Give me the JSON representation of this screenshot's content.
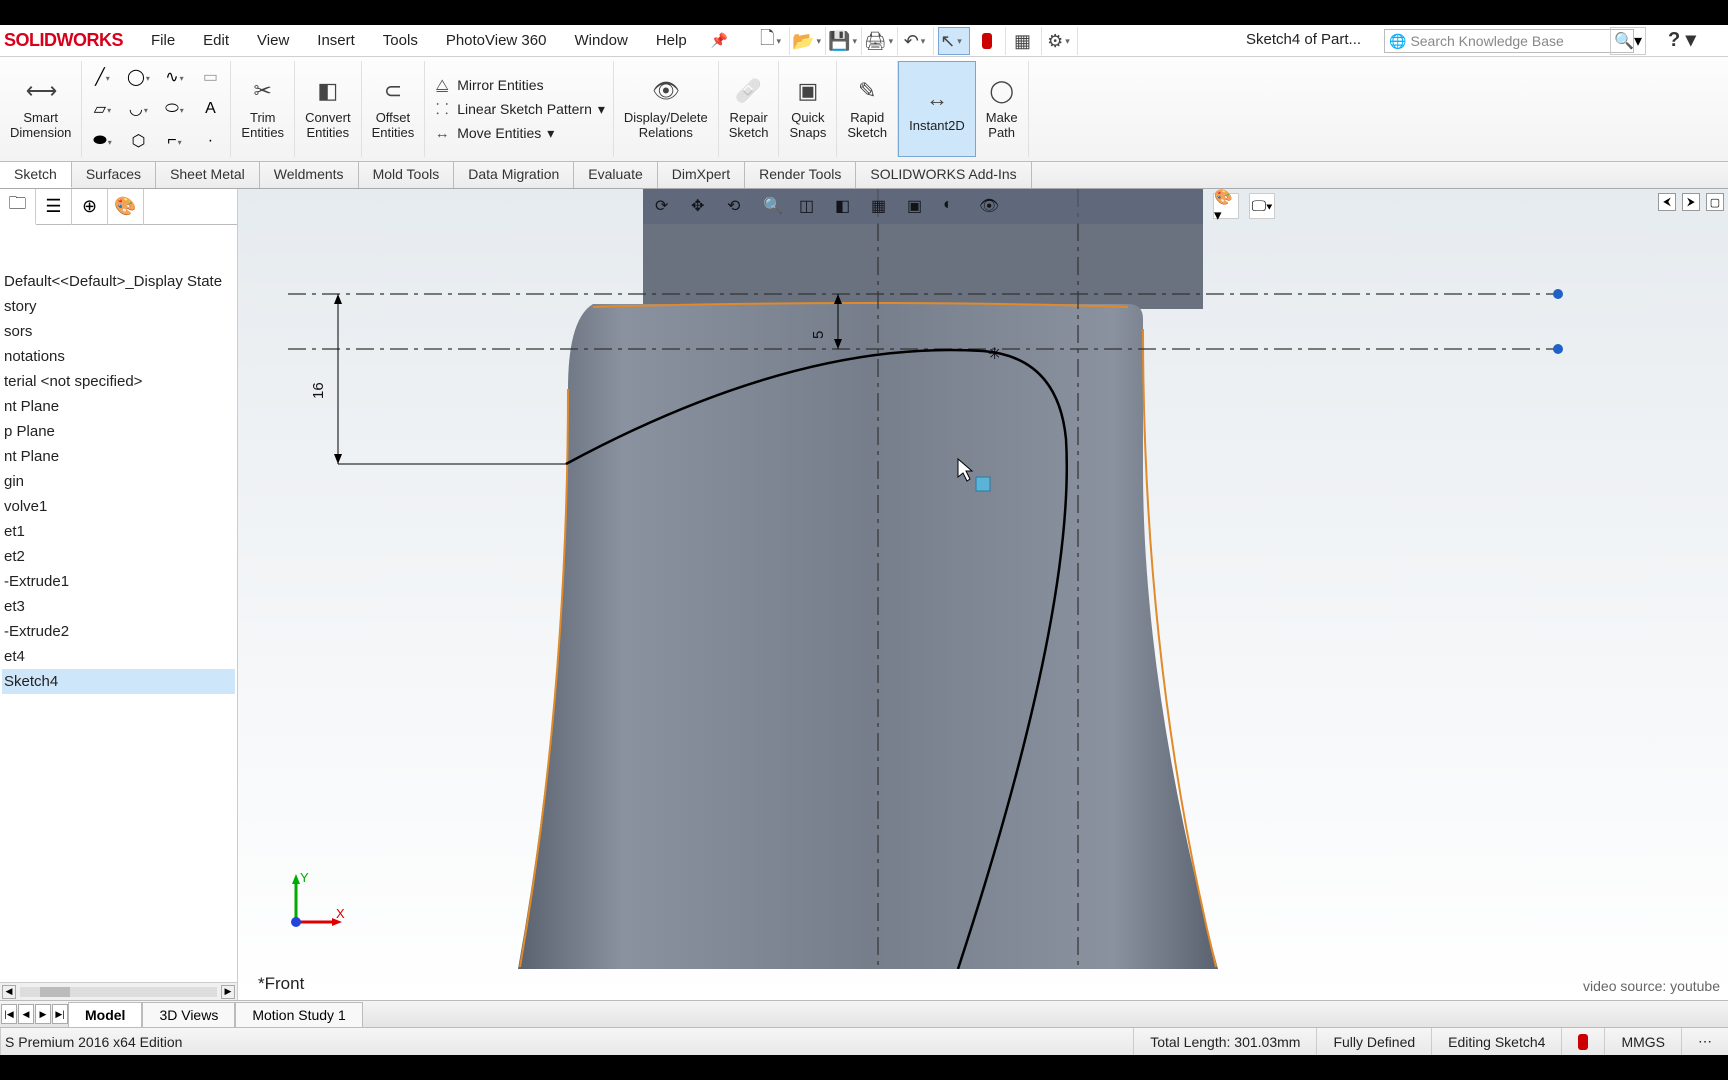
{
  "app": {
    "logo": "SOLIDWORKS",
    "document_title": "Sketch4 of Part...",
    "search_placeholder": "Search Knowledge Base"
  },
  "menu": [
    "File",
    "Edit",
    "View",
    "Insert",
    "Tools",
    "PhotoView 360",
    "Window",
    "Help"
  ],
  "ribbon": {
    "smart_dimension": "Smart\nDimension",
    "trim": "Trim\nEntities",
    "convert": "Convert\nEntities",
    "offset": "Offset\nEntities",
    "mirror": "Mirror Entities",
    "linear_pattern": "Linear Sketch Pattern",
    "move": "Move Entities",
    "display_delete": "Display/Delete\nRelations",
    "repair": "Repair\nSketch",
    "quick_snaps": "Quick\nSnaps",
    "rapid": "Rapid\nSketch",
    "instant2d": "Instant2D",
    "make_path": "Make\nPath"
  },
  "command_tabs": [
    "Sketch",
    "Surfaces",
    "Sheet Metal",
    "Weldments",
    "Mold Tools",
    "Data Migration",
    "Evaluate",
    "DimXpert",
    "Render Tools",
    "SOLIDWORKS Add-Ins"
  ],
  "tree": {
    "display_state": "Default<<Default>_Display State",
    "items": [
      "story",
      "sors",
      "notations",
      "terial <not specified>",
      "nt Plane",
      "p Plane",
      "nt Plane",
      "gin",
      "volve1",
      "et1",
      "et2",
      "-Extrude1",
      "et3",
      "-Extrude2",
      "et4",
      "Sketch4"
    ]
  },
  "viewport": {
    "view_name": "*Front",
    "dim_5": "5",
    "dim_16": "16",
    "watermark": "video source: youtube"
  },
  "bottom_tabs": [
    "Model",
    "3D Views",
    "Motion Study 1"
  ],
  "status": {
    "edition": "S Premium 2016 x64 Edition",
    "length": "Total Length: 301.03mm",
    "defined": "Fully Defined",
    "editing": "Editing Sketch4",
    "units": "MMGS"
  }
}
